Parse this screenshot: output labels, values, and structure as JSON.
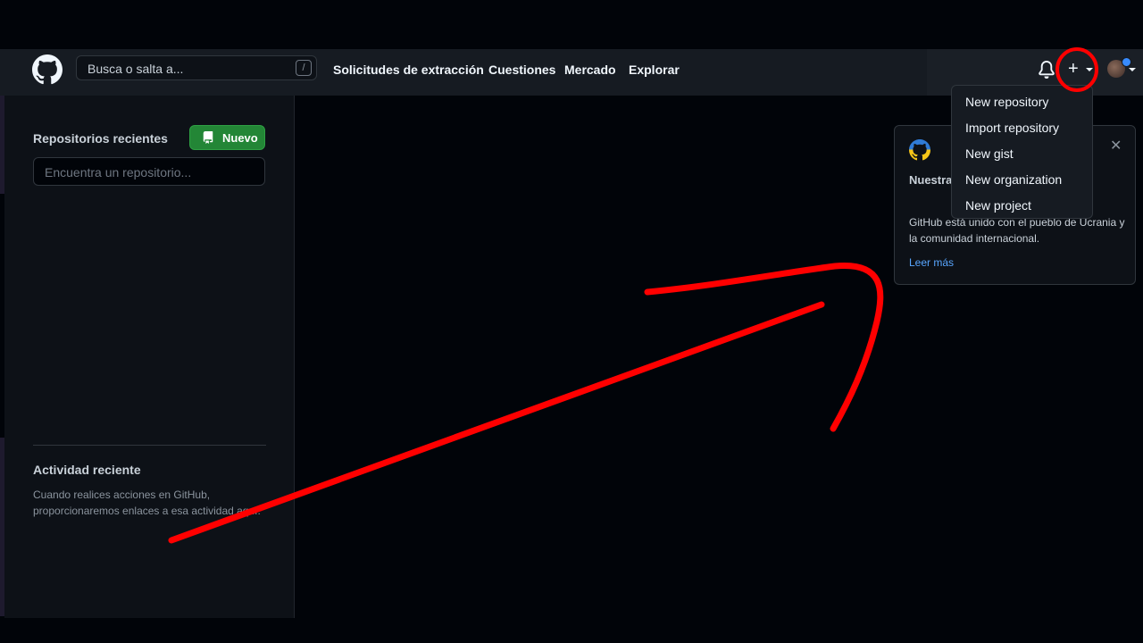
{
  "header": {
    "search_placeholder": "Busca o salta a...",
    "search_shortcut": "/",
    "nav_items": [
      "Solicitudes de extracción",
      "Cuestiones",
      "Mercado",
      "Explorar"
    ]
  },
  "sidebar": {
    "recent_repos_title": "Repositorios recientes",
    "new_button_label": "Nuevo",
    "repo_search_placeholder": "Encuentra un repositorio...",
    "activity_title": "Actividad reciente",
    "activity_text": "Cuando realices acciones en GitHub, proporcionaremos enlaces a esa actividad aquí."
  },
  "create_menu": {
    "items": [
      "New repository",
      "Import repository",
      "New gist",
      "New organization",
      "New project"
    ]
  },
  "notice": {
    "title": "Nuestra solidaridad con Ucrania",
    "body": "GitHub está unido con el pueblo de Ucrania y la comunidad internacional.",
    "link": "Leer más",
    "close": "✕"
  },
  "colors": {
    "annotation": "#ff0000",
    "primary_button": "#238636",
    "link": "#58a6ff",
    "notification_dot": "#388bfd"
  },
  "icons": [
    "github-logo-icon",
    "bell-icon",
    "plus-icon",
    "repo-icon",
    "close-icon",
    "avatar"
  ]
}
